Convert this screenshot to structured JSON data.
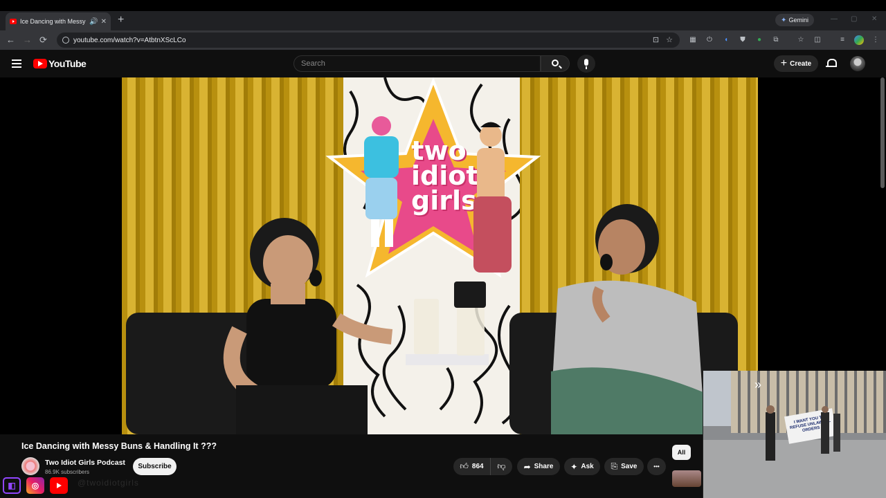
{
  "browser": {
    "tab_title": "Ice Dancing with Messy Buns",
    "new_tab": "+",
    "gemini_label": "Gemini",
    "url": "youtube.com/watch?v=AtbtnXScLCo",
    "back": "←",
    "forward": "→",
    "reload": "⟳"
  },
  "youtube": {
    "logo_text": "YouTube",
    "search_placeholder": "Search",
    "create_label": "Create"
  },
  "video": {
    "show_logo": "two idiot girls",
    "title": "Ice Dancing with Messy Buns & Handling It ???",
    "channel_name": "Two Idiot Girls Podcast",
    "subscribers": "86.9K subscribers",
    "subscribe_label": "Subscribe",
    "like_count": "864",
    "share_label": "Share",
    "ask_label": "Ask",
    "save_label": "Save",
    "more_label": "•••"
  },
  "side": {
    "filter_chip": "All"
  },
  "mini_player": {
    "banner_text": "I WANT YOU TO REFUSE UNLAWFUL ORDERS"
  },
  "overlay": {
    "faded_text": "@twoidiotgirls"
  },
  "colors": {
    "youtube_red": "#ff0000",
    "background": "#0f0f0f",
    "curtain_gold": "#d9b332"
  }
}
